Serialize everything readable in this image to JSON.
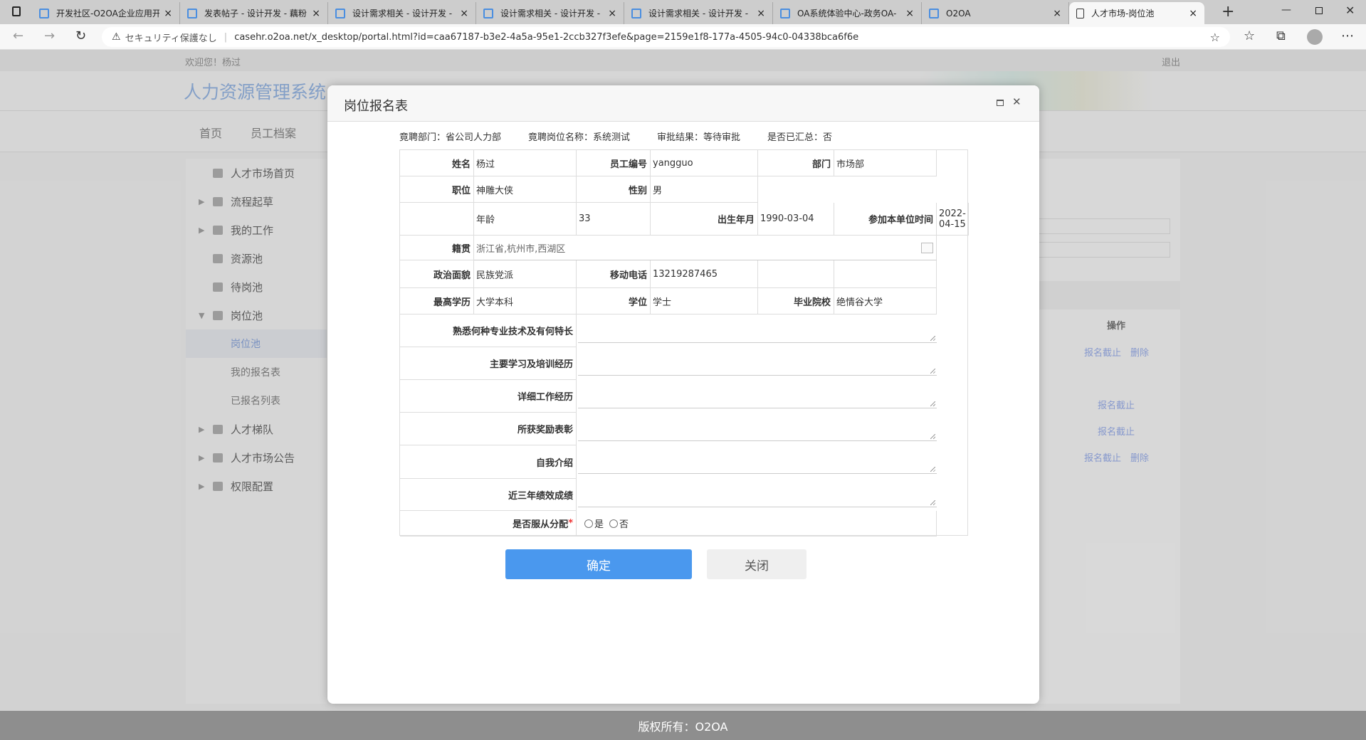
{
  "browser": {
    "tabs": [
      {
        "title": "开发社区-O2OA企业应用开"
      },
      {
        "title": "发表帖子 - 设计开发 - 藕粉"
      },
      {
        "title": "设计需求相关 - 设计开发 -"
      },
      {
        "title": "设计需求相关 - 设计开发 -"
      },
      {
        "title": "设计需求相关 - 设计开发 -"
      },
      {
        "title": "OA系统体验中心-政务OA-"
      },
      {
        "title": "O2OA"
      },
      {
        "title": "人才市场-岗位池"
      }
    ],
    "security": "セキュリティ保護なし",
    "url": "casehr.o2oa.net/x_desktop/portal.html?id=caa67187-b3e2-4a5a-95e1-2ccb327f3efe&page=2159e1f8-177a-4505-94c0-04338bca6f6e"
  },
  "app": {
    "welcome": "欢迎您！杨过",
    "logout": "退出",
    "title": "人力资源管理系统",
    "nav": [
      "首页",
      "员工档案"
    ],
    "sidebar": [
      {
        "label": "人才市场首页"
      },
      {
        "label": "流程起草"
      },
      {
        "label": "我的工作"
      },
      {
        "label": "资源池"
      },
      {
        "label": "待岗池"
      },
      {
        "label": "岗位池"
      },
      {
        "label": "岗位池"
      },
      {
        "label": "我的报名表"
      },
      {
        "label": "已报名列表"
      },
      {
        "label": "人才梯队"
      },
      {
        "label": "人才市场公告"
      },
      {
        "label": "权限配置"
      }
    ],
    "table": {
      "op_header": "操作",
      "actions": [
        "报名截止",
        "删除",
        "报名截止",
        "报名截止",
        "报名截止",
        "删除"
      ]
    },
    "footer": "版权所有：O2OA"
  },
  "dialog": {
    "title": "岗位报名表",
    "info": [
      "竟聘部门：省公司人力部",
      "竟聘岗位名称：系统测试",
      "审批结果：等待审批",
      "是否已汇总：否"
    ],
    "fields": {
      "name_l": "姓名",
      "name": "杨过",
      "empno_l": "员工编号",
      "empno": "yangguo",
      "dept_l": "部门",
      "dept": "市场部",
      "pos_l": "职位",
      "pos": "神雕大侠",
      "sex_l": "性别",
      "sex": "男",
      "age_l": "年龄",
      "age": "33",
      "birth_l": "出生年月",
      "birth": "1990-03-04",
      "join_l": "参加本单位时间",
      "join": "2022-04-15",
      "native_l": "籍贯",
      "native": "浙江省,杭州市,西湖区",
      "party_l": "政治面貌",
      "party": "民族党派",
      "phone_l": "移动电话",
      "phone": "13219287465",
      "edu_l": "最高学历",
      "edu": "大学本科",
      "degree_l": "学位",
      "degree": "学士",
      "school_l": "毕业院校",
      "school": "绝情谷大学",
      "skill_l": "熟悉何种专业技术及有何特长",
      "study_l": "主要学习及培训经历",
      "work_l": "详细工作经历",
      "award_l": "所获奖励表彰",
      "intro_l": "自我介绍",
      "perf_l": "近三年绩效成绩",
      "assign_l": "是否服从分配",
      "yes": "是",
      "no": "否"
    },
    "ok": "确定",
    "close": "关闭"
  }
}
